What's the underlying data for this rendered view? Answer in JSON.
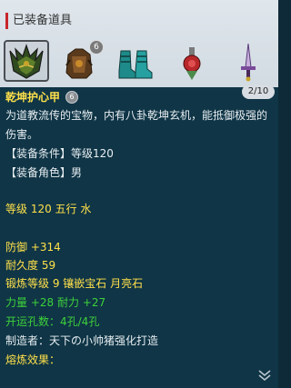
{
  "header": {
    "title": "已装备道具"
  },
  "equipment_slots": [
    {
      "icon": "helmet-icon",
      "selected": true,
      "badge": ""
    },
    {
      "icon": "armor-icon",
      "selected": false,
      "badge": "6"
    },
    {
      "icon": "boots-icon",
      "selected": false,
      "badge": ""
    },
    {
      "icon": "accessory-icon",
      "selected": false,
      "badge": ""
    },
    {
      "icon": "sword-icon",
      "selected": false,
      "badge": ""
    }
  ],
  "item": {
    "name": "乾坤护心甲",
    "refine_badge": "6",
    "page": "2/10",
    "description": "为道教流传的宝物，内有八卦乾坤玄机，能抵御极强的伤害。",
    "requirement": "【装备条件】等级120",
    "role": "【装备角色】男",
    "level_element": "等级 120 五行 水",
    "defense": "防御 +314",
    "durability": "耐久度 59",
    "forge": "锻炼等级 9 镶嵌宝石 月亮石",
    "stats": "力量 +28 耐力 +27",
    "holes": "开运孔数：4孔/4孔",
    "maker": "制造者：天下の小帅猪强化打造",
    "effect": "熔炼效果："
  },
  "colors": {
    "header_bg": "#d8e0e6",
    "tooltip_bg": "#0f3546",
    "name_yellow": "#ffe04a",
    "stat_green": "#3ed13a",
    "accent_red": "#c8262a"
  }
}
